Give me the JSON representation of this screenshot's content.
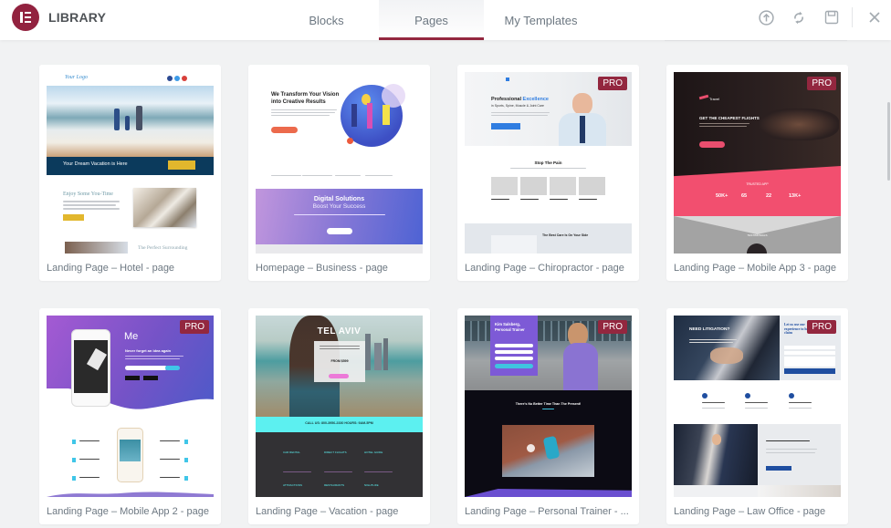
{
  "header": {
    "title": "LIBRARY",
    "tabs": [
      {
        "label": "Blocks",
        "active": false
      },
      {
        "label": "Pages",
        "active": true
      },
      {
        "label": "My Templates",
        "active": false
      }
    ],
    "icons": [
      "upload-icon",
      "sync-icon",
      "save-icon",
      "close-icon"
    ]
  },
  "colors": {
    "brand": "#92223f",
    "pro_badge": "#93273f",
    "background": "#f1f2f3",
    "text_muted": "#6d7882"
  },
  "pro_label": "PRO",
  "templates": [
    {
      "title": "Landing Page – Hotel - page",
      "pro": false,
      "thumb": {
        "logo": "Your Logo",
        "banner": "Your Dream Vacation is Here",
        "heading": "Enjoy Some You-Time",
        "footer_heading": "The Perfect Surrounding"
      }
    },
    {
      "title": "Homepage – Business - page",
      "pro": false,
      "thumb": {
        "heading_1": "We Transform Your Vision",
        "heading_2": "into Creative Results",
        "band_title": "Digital Solutions",
        "band_subtitle": "Boost Your Success"
      }
    },
    {
      "title": "Landing Page – Chiropractor - page",
      "pro": true,
      "thumb": {
        "heading_1": "Professional",
        "heading_accent": "Excellence",
        "subheading": "in Sports, Spine, Muscle & Joint Care",
        "section_title": "Stop The Pain",
        "lower_title": "The Best Care Is On Your Side"
      }
    },
    {
      "title": "Landing Page – Mobile App 3 - page",
      "pro": true,
      "thumb": {
        "brand": "Travel",
        "heading": "GET THE CHEAPEST FLIGHTS",
        "band_title": "TRUSTED APP",
        "stats": [
          "50K+",
          "65",
          "22",
          "13K+"
        ],
        "lower_title": "TESTIMONIALS"
      }
    },
    {
      "title": "Landing Page – Mobile App 2 - page",
      "pro": true,
      "thumb": {
        "brand": "Me",
        "heading": "Never forget an idea again"
      }
    },
    {
      "title": "Landing Page – Vacation - page",
      "pro": false,
      "thumb": {
        "heading": "TEL AVIV",
        "price": "FROM $599",
        "band": "CALL US: 800-3956-2330 HOURS: 9AM-5PM",
        "features": [
          "CAR RENTAL",
          "DIRECT FLIGHTS",
          "HOTEL GUIDE",
          "ATTRACTIONS",
          "RESTAURANTS",
          "NIGHTLIFE"
        ]
      }
    },
    {
      "title": "Landing Page – Personal Trainer - ...",
      "pro": true,
      "thumb": {
        "name": "Kim Salsberg,",
        "role": "Personal Trainer",
        "section_title": "There's No Better Time Than The Present!"
      }
    },
    {
      "title": "Landing Page – Law Office - page",
      "pro": true,
      "thumb": {
        "heading": "NEED LITIGATION?",
        "form_title": "Let us use our experience to help you claim"
      }
    }
  ]
}
